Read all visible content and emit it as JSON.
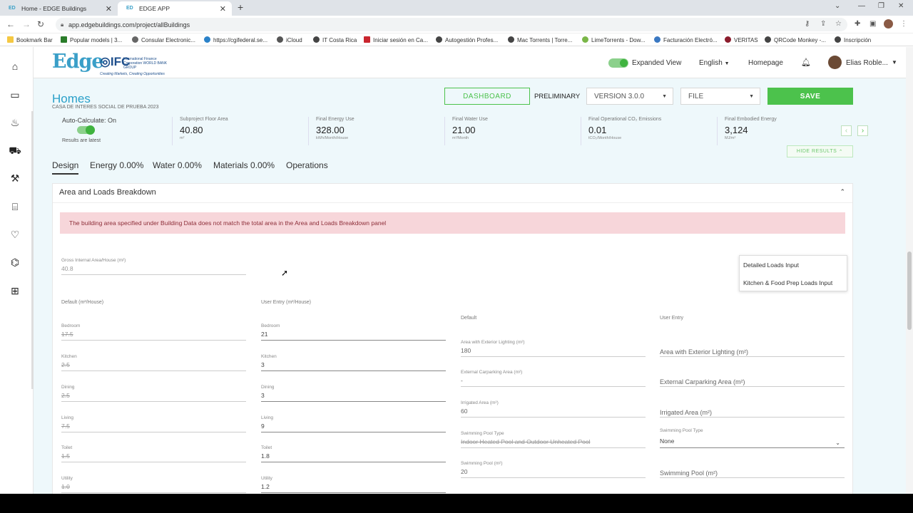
{
  "browser": {
    "tabs": [
      {
        "title": "Home - EDGE Buildings",
        "favicon": "EDGE"
      },
      {
        "title": "EDGE APP",
        "favicon": "EDGE"
      }
    ],
    "url": "app.edgebuildings.com/project/allBuildings",
    "bookmarks": [
      "Bookmark Bar",
      "Popular models | 3...",
      "Consular Electronic...",
      "https://cgifederal.se...",
      "iCloud",
      "IT Costa Rica",
      "Iniciar sesión en Ca...",
      "Autogestión Profes...",
      "Mac Torrents | Torre...",
      "LimeTorrents - Dow...",
      "Facturación Electró...",
      "VERITAS",
      "QRCode Monkey -...",
      "Inscripción"
    ]
  },
  "header": {
    "logo": "Edge",
    "ifc_logo": "IFC",
    "ifc_name": "International Finance Corporation WORLD BANK GROUP",
    "ifc_tagline": "Creating Markets, Creating Opportunities",
    "expanded_view_label": "Expanded View",
    "language": "English",
    "homepage_label": "Homepage",
    "user_name": "Elias Roble..."
  },
  "project": {
    "title": "Homes",
    "subtitle": "CASA DE INTERES SOCIAL DE PRUEBA 2023",
    "dashboard_label": "DASHBOARD",
    "preliminary_label": "PRELIMINARY",
    "version_label": "VERSION 3.0.0",
    "file_label": "FILE",
    "save_label": "SAVE"
  },
  "results": {
    "autocalc_label": "Auto-Calculate: On",
    "latest_label": "Results are latest",
    "metrics": [
      {
        "label": "Subproject Floor Area",
        "value": "40.80",
        "unit": "m²"
      },
      {
        "label": "Final Energy Use",
        "value": "328.00",
        "unit": "kWh/Month/House"
      },
      {
        "label": "Final Water Use",
        "value": "21.00",
        "unit": "m³/Month"
      },
      {
        "label": "Final Operational CO₂ Emissions",
        "value": "0.01",
        "unit": "tCO₂/Month/House"
      },
      {
        "label": "Final Embodied Energy",
        "value": "3,124",
        "unit": "MJ/m²"
      }
    ],
    "hide_label": "HIDE RESULTS"
  },
  "tabs": [
    "Design",
    "Energy 0.00%",
    "Water 0.00%",
    "Materials 0.00%",
    "Operations"
  ],
  "panel": {
    "title": "Area and Loads Breakdown",
    "alert": "The building area specified under Building Data does not match the total area in the Area and Loads Breakdown panel",
    "gross_label": "Gross Internal Area/House (m²)",
    "gross_value": "40.8",
    "default_head": "Default (m²/House)",
    "user_head": "User Entry (m²/House)",
    "rooms": [
      {
        "label": "Bedroom",
        "default": "17.5",
        "user": "21"
      },
      {
        "label": "Kitchen",
        "default": "2.5",
        "user": "3"
      },
      {
        "label": "Dining",
        "default": "2.5",
        "user": "3"
      },
      {
        "label": "Living",
        "default": "7.5",
        "user": "9"
      },
      {
        "label": "Toilet",
        "default": "1.5",
        "user": "1.8"
      },
      {
        "label": "Utility",
        "default": "1.0",
        "user": "1.2"
      }
    ],
    "ext_default_head": "Default",
    "ext_user_head": "User Entry",
    "ext_fields": [
      {
        "label": "Area with Exterior Lighting (m²)",
        "default": "180",
        "user_placeholder": "Area with Exterior Lighting (m²)"
      },
      {
        "label": "External Carparking Area (m²)",
        "default": "-",
        "user_placeholder": "External Carparking Area (m²)"
      },
      {
        "label": "Irrigated Area (m²)",
        "default": "60",
        "user_placeholder": "Irrigated Area (m²)"
      },
      {
        "label": "Swimming Pool Type",
        "default": "Indoor Heated Pool and Outdoor Unheated Pool",
        "user_label": "Swimming Pool Type",
        "user_value": "None"
      },
      {
        "label": "Swimming Pool (m²)",
        "default": "20",
        "user_placeholder": "Swimming Pool (m²)"
      }
    ],
    "menu": [
      "Detailed Loads Input",
      "Kitchen & Food Prep Loads Input"
    ]
  },
  "colors": {
    "accent": "#2aa0c9",
    "green": "#4cc24c",
    "alert_bg": "#f7d6da"
  }
}
